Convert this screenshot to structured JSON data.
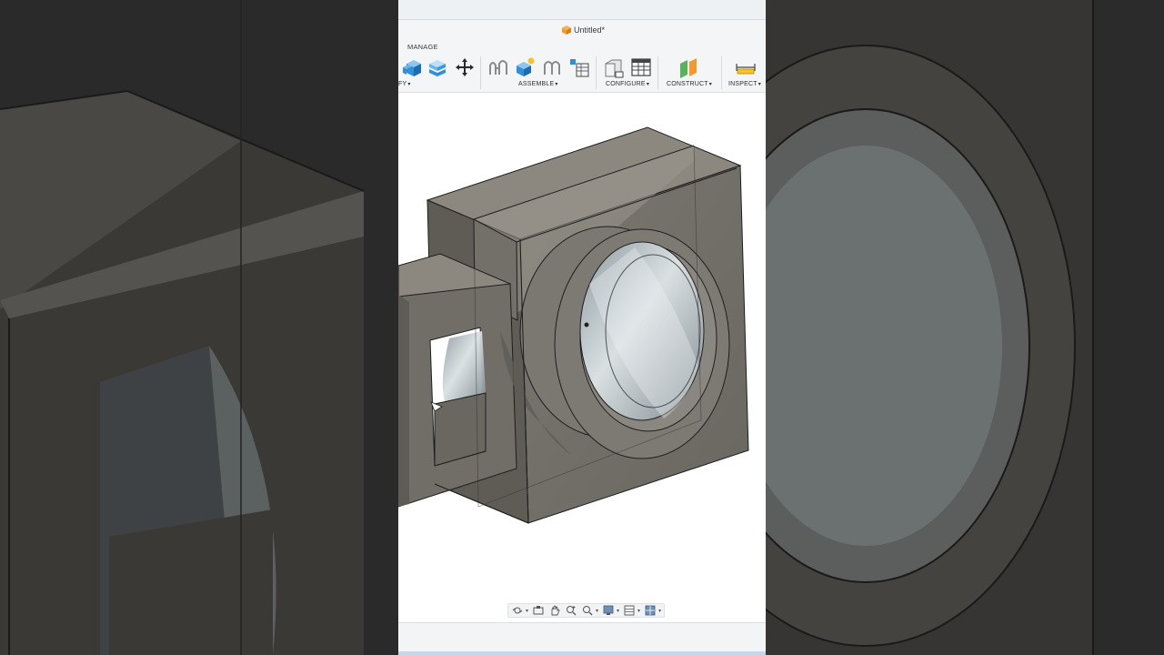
{
  "document": {
    "title": "Untitled*"
  },
  "ribbon": {
    "tab_label": "MANAGE",
    "groups": [
      {
        "label": "FY",
        "caret": "▾"
      },
      {
        "label": "ASSEMBLE",
        "caret": "▾"
      },
      {
        "label": "CONFIGURE",
        "caret": "▾"
      },
      {
        "label": "CONSTRUCT",
        "caret": "▾"
      },
      {
        "label": "INSPECT",
        "caret": "▾"
      }
    ],
    "tools": [
      "solid-box-icon",
      "combine-icon",
      "move-icon",
      "joint-icon",
      "new-component-icon",
      "as-built-joint-icon",
      "joint-origin-icon",
      "configure-icon",
      "table-icon",
      "offset-plane-icon",
      "measure-icon"
    ]
  },
  "navigation_bar": {
    "tools": [
      "orbit-icon",
      "look-at-icon",
      "pan-icon",
      "zoom-icon",
      "zoom-window-icon",
      "display-settings-icon",
      "grid-icon",
      "viewports-icon"
    ]
  },
  "colors": {
    "accent": "#f29a2e",
    "model_face_dark": "#6f6c66",
    "model_face_light": "#a19d95",
    "bore": "#b9c2c6"
  }
}
